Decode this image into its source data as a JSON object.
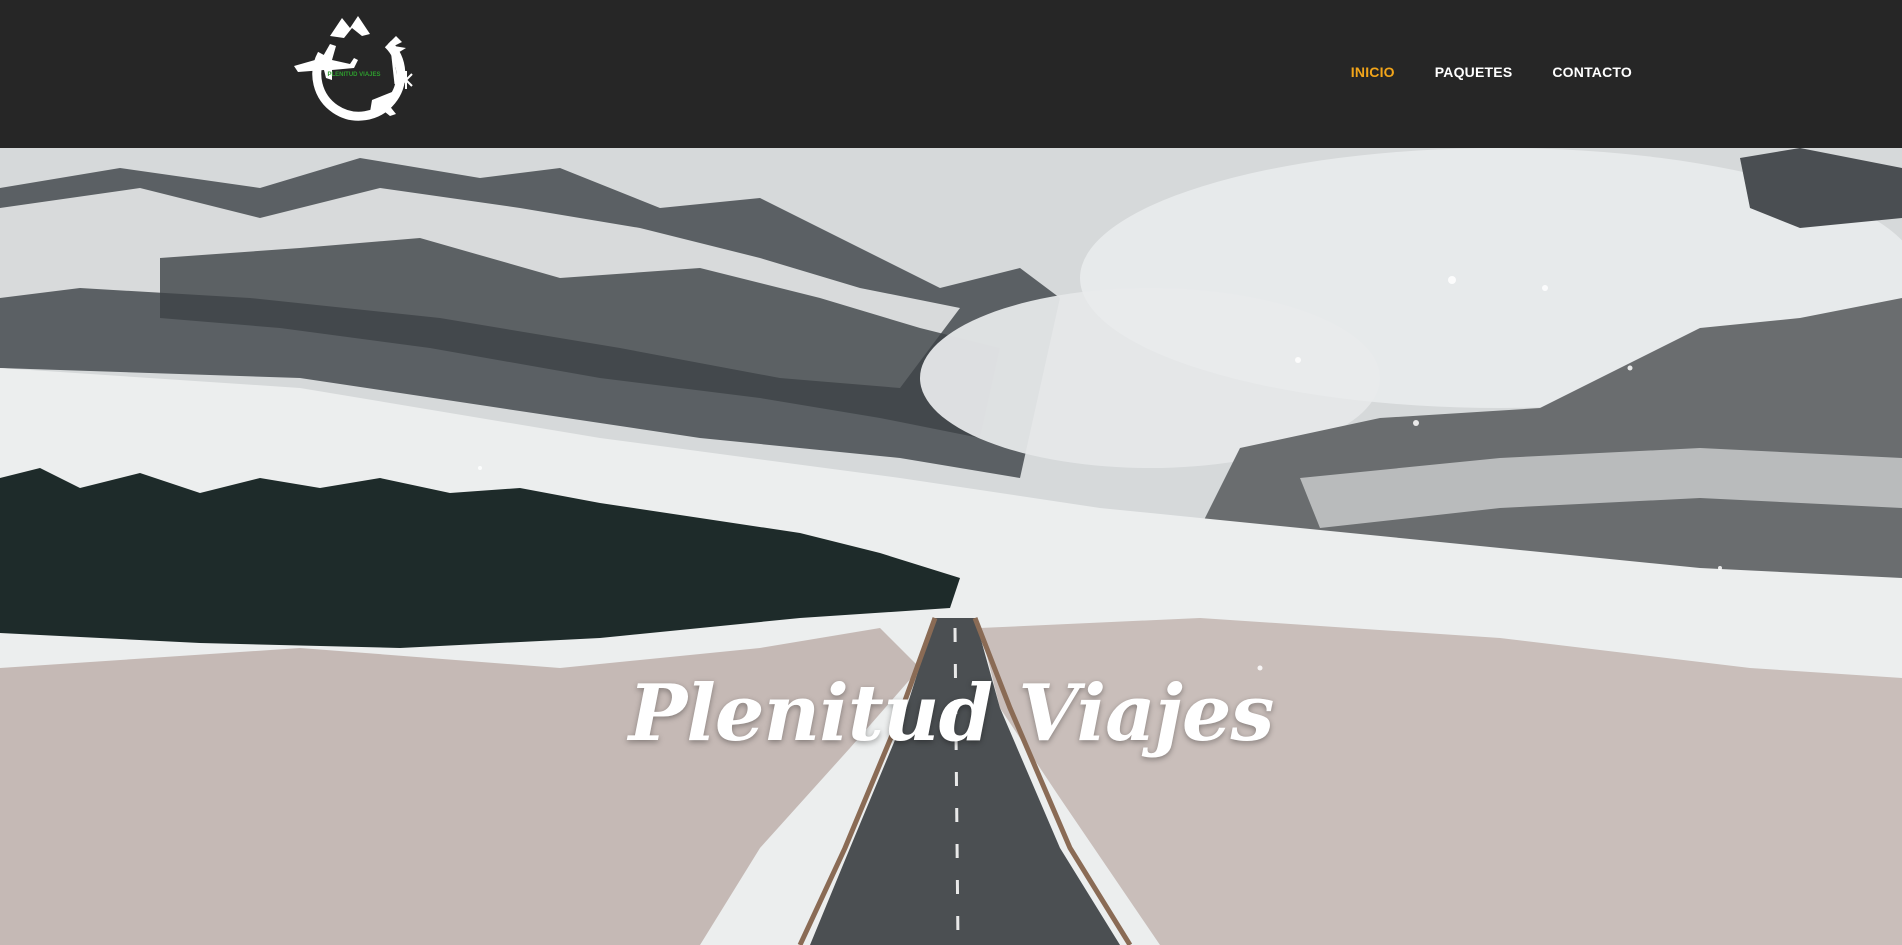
{
  "header": {
    "logo_text": "PLENITUD VIAJES",
    "nav": [
      {
        "label": "INICIO",
        "active": true
      },
      {
        "label": "PAQUETES",
        "active": false
      },
      {
        "label": "CONTACTO",
        "active": false
      }
    ],
    "active_color": "#f2a51a",
    "background": "#262626"
  },
  "hero": {
    "title": "Plenitud Viajes",
    "image": "snowy-mountain-road"
  }
}
